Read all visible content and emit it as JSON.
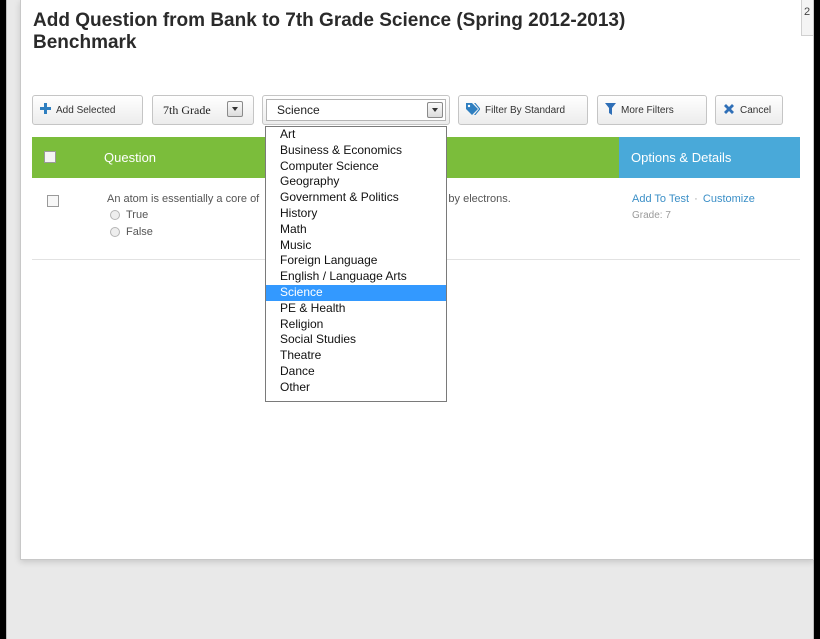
{
  "page": {
    "corner_number": "2"
  },
  "dialog": {
    "title_line1": "Add Question from Bank to 7th Grade Science (Spring 2012-2013)",
    "title_line2": "Benchmark"
  },
  "toolbar": {
    "add_selected_label": "Add Selected",
    "grade_select_value": "7th Grade",
    "subject_select_value": "Science",
    "filter_by_standard_label": "Filter By Standard",
    "more_filters_label": "More Filters",
    "cancel_label": "Cancel"
  },
  "table": {
    "col_question": "Question",
    "col_options": "Options & Details"
  },
  "question": {
    "text_start": "An atom is essentially a core of",
    "text_end": "d by electrons.",
    "options": [
      "True",
      "False"
    ],
    "add_to_test_label": "Add To Test",
    "separator": "·",
    "customize_label": "Customize",
    "grade_text": "Grade: 7"
  },
  "subject_dropdown": {
    "options": [
      "Art",
      "Business & Economics",
      "Computer Science",
      "Geography",
      "Government & Politics",
      "History",
      "Math",
      "Music",
      "Foreign Language",
      "English / Language Arts",
      "Science",
      "PE & Health",
      "Religion",
      "Social Studies",
      "Theatre",
      "Dance",
      "Other"
    ],
    "selected": "Science"
  },
  "colors": {
    "question_header": "#7bbd3b",
    "options_header": "#49a9d9",
    "link": "#3b8fc7",
    "selection": "#3399ff",
    "add_icon": "#2f7fc0",
    "cancel_icon": "#2f6fb7"
  }
}
